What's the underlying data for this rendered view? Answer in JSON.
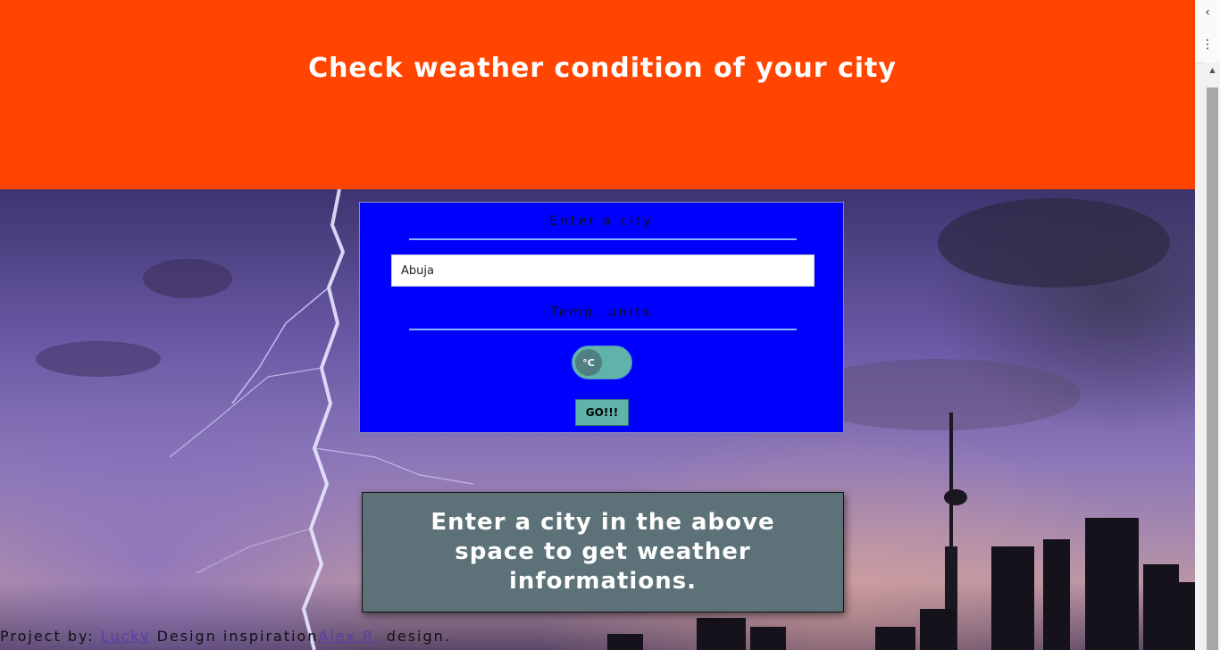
{
  "header": {
    "title": "Check weather condition of your city"
  },
  "form": {
    "city_label": "Enter a city",
    "city_value": "Abuja",
    "units_label": "Temp. units",
    "unit_toggle": "°C",
    "submit_label": "GO!!!"
  },
  "result": {
    "message": "Enter a city in the above space to get weather informations."
  },
  "footer": {
    "prefix": "Project by: ",
    "author_link": "Lucky",
    "middle": " Design inspiration",
    "inspiration_link": "Alex R.",
    "suffix": " design."
  },
  "browser": {
    "back_glyph": "‹",
    "menu_glyph": "⋮",
    "scroll_up_glyph": "▲"
  },
  "colors": {
    "header_bg": "#ff4500",
    "form_bg": "#0000ff",
    "accent_teal": "#5fb3a8",
    "result_bg": "#5c7278"
  }
}
